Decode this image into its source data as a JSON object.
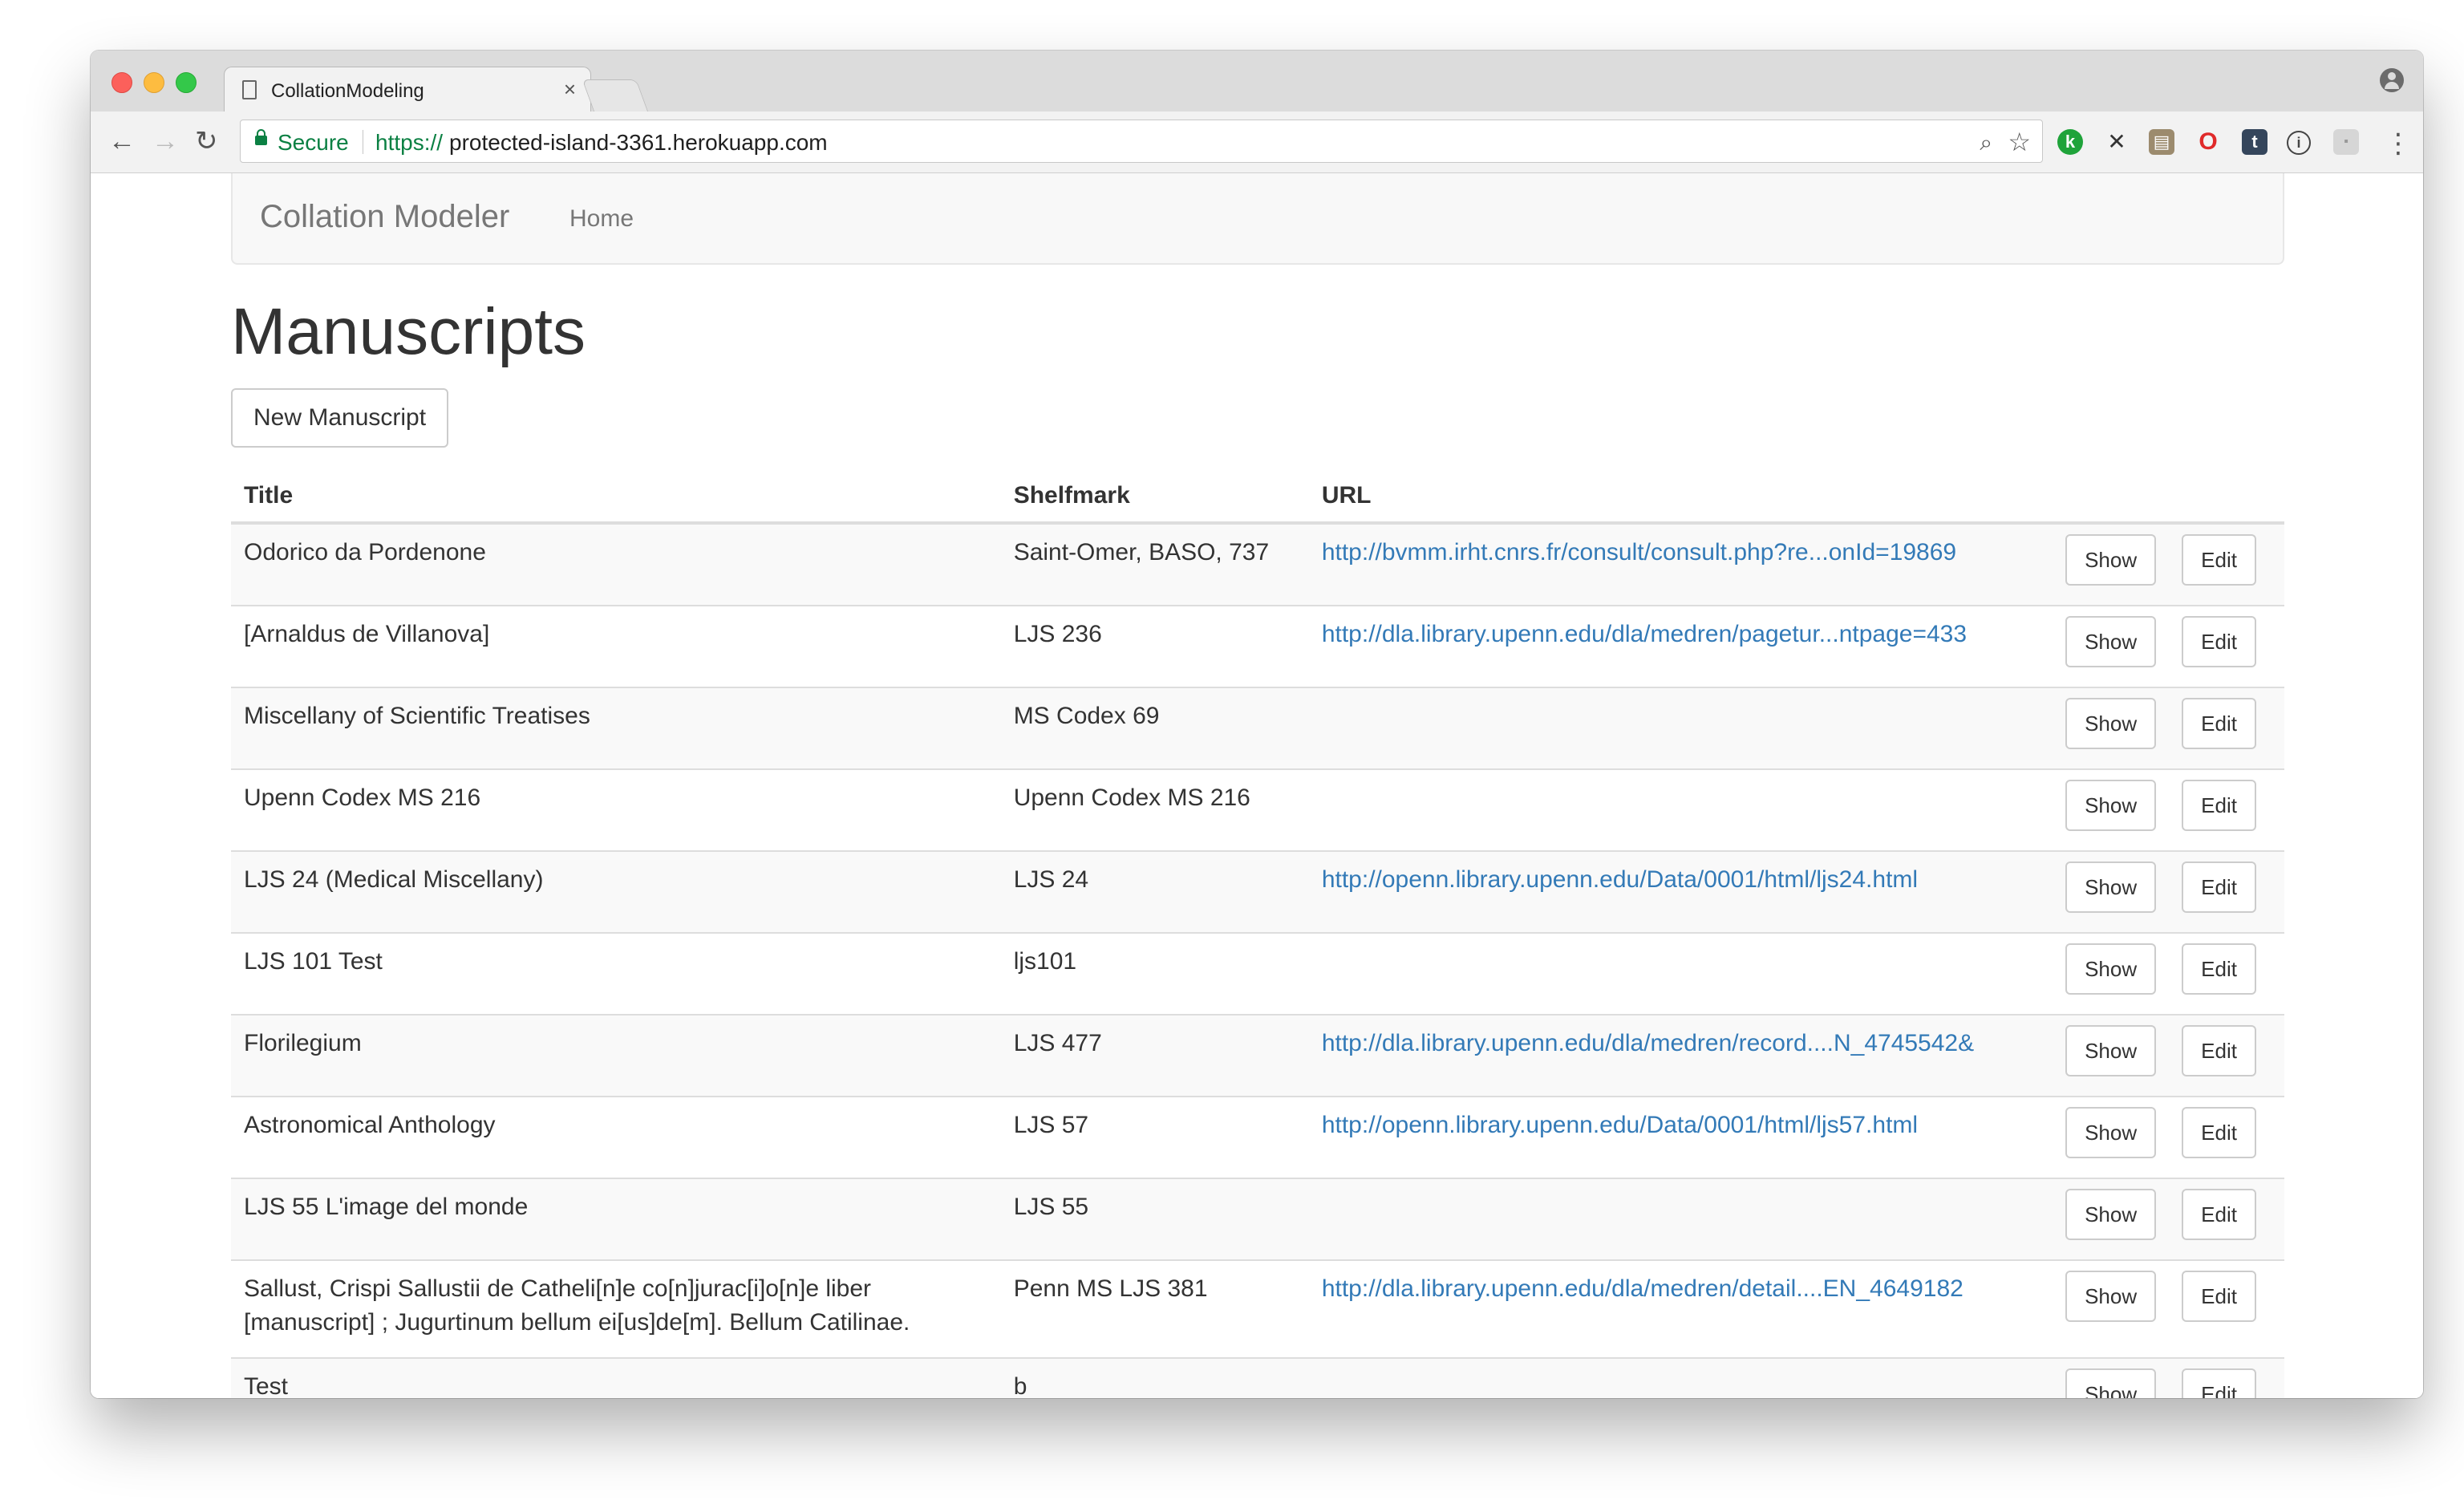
{
  "browser": {
    "tab_title": "CollationModeling",
    "tab_close": "×",
    "secure_label": "Secure",
    "url_scheme": "https://",
    "url_host": "protected-island-3361.herokuapp.com"
  },
  "navbar": {
    "brand": "Collation Modeler",
    "home": "Home"
  },
  "page": {
    "title": "Manuscripts",
    "new_button": "New Manuscript"
  },
  "table": {
    "headers": {
      "title": "Title",
      "shelfmark": "Shelfmark",
      "url": "URL"
    },
    "show_label": "Show",
    "edit_label": "Edit",
    "rows": [
      {
        "title": "Odorico da Pordenone",
        "shelfmark": "Saint-Omer, BASO, 737",
        "url": "http://bvmm.irht.cnrs.fr/consult/consult.php?re...onId=19869"
      },
      {
        "title": "[Arnaldus de Villanova]",
        "shelfmark": "LJS 236",
        "url": "http://dla.library.upenn.edu/dla/medren/pagetur...ntpage=433"
      },
      {
        "title": "Miscellany of Scientific Treatises",
        "shelfmark": "MS Codex 69",
        "url": ""
      },
      {
        "title": "Upenn Codex MS 216",
        "shelfmark": "Upenn Codex MS 216",
        "url": ""
      },
      {
        "title": "LJS 24 (Medical Miscellany)",
        "shelfmark": "LJS 24",
        "url": "http://openn.library.upenn.edu/Data/0001/html/ljs24.html"
      },
      {
        "title": "LJS 101 Test",
        "shelfmark": "ljs101",
        "url": ""
      },
      {
        "title": "Florilegium",
        "shelfmark": "LJS 477",
        "url": "http://dla.library.upenn.edu/dla/medren/record....N_4745542&"
      },
      {
        "title": "Astronomical Anthology",
        "shelfmark": "LJS 57",
        "url": "http://openn.library.upenn.edu/Data/0001/html/ljs57.html"
      },
      {
        "title": "LJS 55 L'image del monde",
        "shelfmark": "LJS 55",
        "url": ""
      },
      {
        "title": "Sallust, Crispi Sallustii de Catheli[n]e co[n]jurac[i]o[n]e liber [manuscript] ; Jugurtinum bellum ei[us]de[m]. Bellum Catilinae.",
        "shelfmark": "Penn MS LJS 381",
        "url": "http://dla.library.upenn.edu/dla/medren/detail....EN_4649182"
      },
      {
        "title": "Test",
        "shelfmark": "b",
        "url": ""
      }
    ]
  }
}
